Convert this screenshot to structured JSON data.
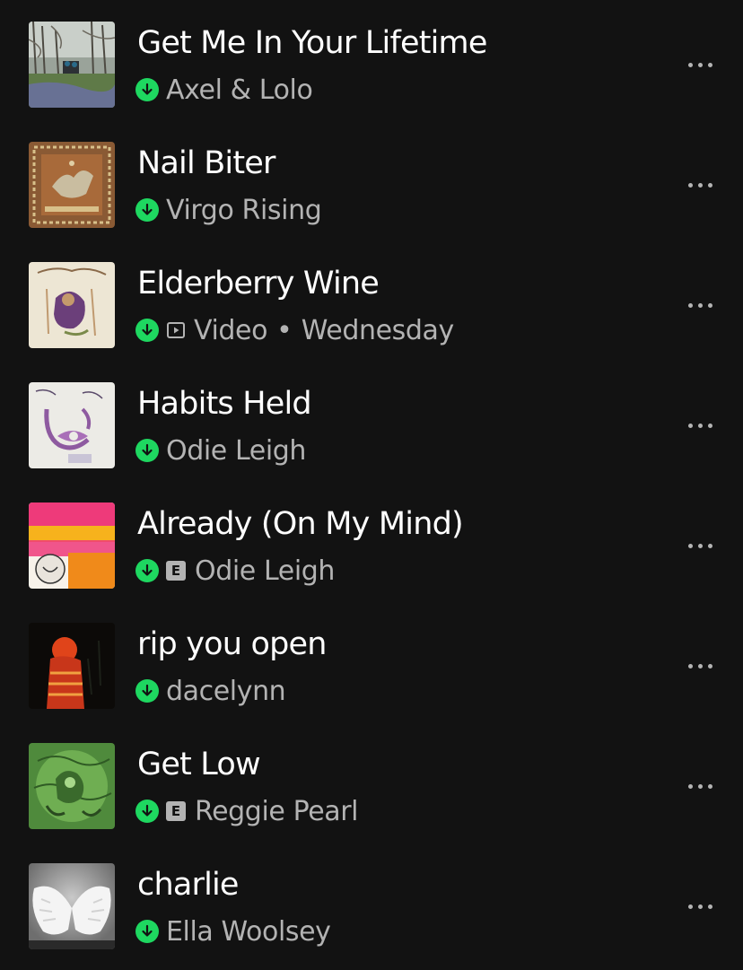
{
  "tracks": [
    {
      "title": "Get Me In Your Lifetime",
      "artist": "Axel & Lolo",
      "downloaded": true,
      "explicit": false,
      "video": false,
      "artwork_icon": "album-art-icon"
    },
    {
      "title": "Nail Biter",
      "artist": "Virgo Rising",
      "downloaded": true,
      "explicit": false,
      "video": false,
      "artwork_icon": "album-art-icon"
    },
    {
      "title": "Elderberry Wine",
      "video_label": "Video",
      "separator": "•",
      "artist": "Wednesday",
      "downloaded": true,
      "explicit": false,
      "video": true,
      "artwork_icon": "album-art-icon"
    },
    {
      "title": "Habits Held",
      "artist": "Odie Leigh",
      "downloaded": true,
      "explicit": false,
      "video": false,
      "artwork_icon": "album-art-icon"
    },
    {
      "title": "Already (On My Mind)",
      "artist": "Odie Leigh",
      "downloaded": true,
      "explicit": true,
      "explicit_label": "E",
      "video": false,
      "artwork_icon": "album-art-icon"
    },
    {
      "title": "rip you open",
      "artist": "dacelynn",
      "downloaded": true,
      "explicit": false,
      "video": false,
      "artwork_icon": "album-art-icon"
    },
    {
      "title": "Get Low",
      "artist": "Reggie Pearl",
      "downloaded": true,
      "explicit": true,
      "explicit_label": "E",
      "video": false,
      "artwork_icon": "album-art-icon"
    },
    {
      "title": "charlie",
      "artist": "Ella Woolsey",
      "downloaded": true,
      "explicit": false,
      "video": false,
      "artwork_icon": "album-art-icon"
    }
  ],
  "colors": {
    "background": "#121212",
    "title": "#ffffff",
    "subtitle": "#b3b3b3",
    "accent_green": "#1ed760"
  },
  "icons": {
    "download": "download-arrow-icon",
    "explicit": "explicit-badge-icon",
    "video": "video-play-icon",
    "more": "more-options-icon"
  }
}
